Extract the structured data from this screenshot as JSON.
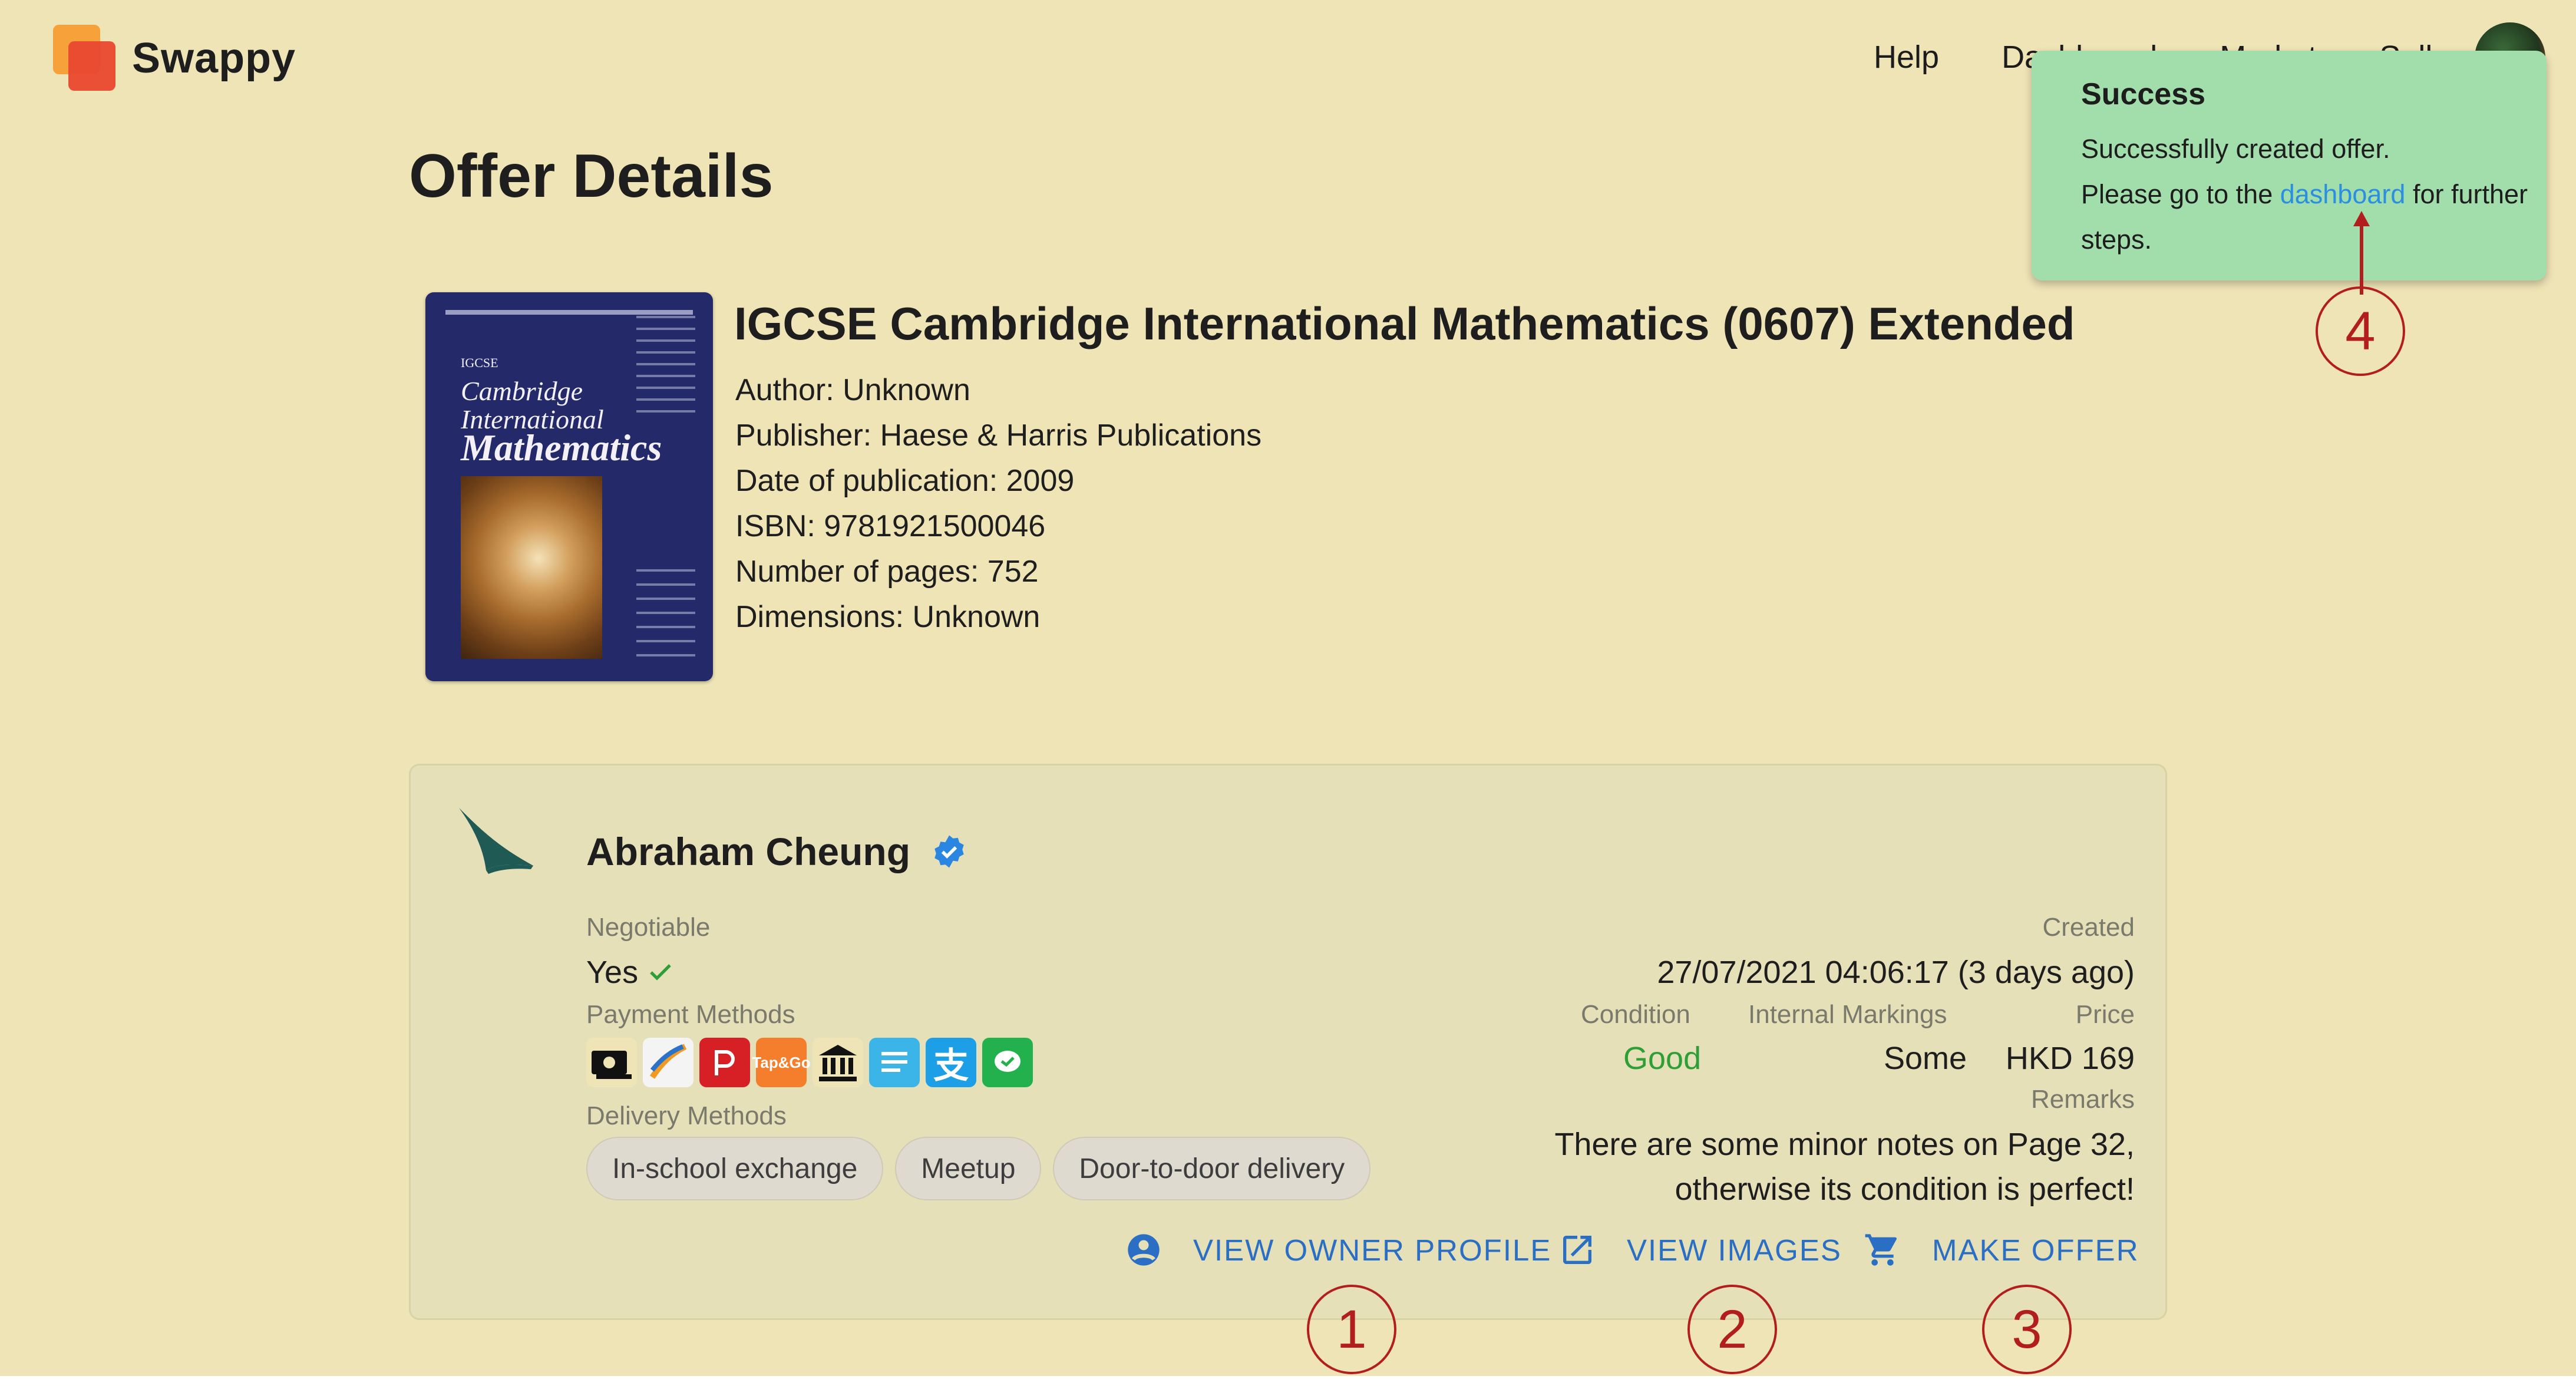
{
  "app": {
    "name": "Swappy"
  },
  "nav": {
    "items": [
      "Help",
      "Dashboard",
      "Market",
      "Sell"
    ]
  },
  "toast": {
    "title": "Success",
    "line1": "Successfully created offer.",
    "before_link": "Please go to the ",
    "link": "dashboard",
    "after_link": " for further steps."
  },
  "annotations": [
    "1",
    "2",
    "3",
    "4"
  ],
  "page": {
    "title": "Offer Details"
  },
  "book": {
    "title": "IGCSE Cambridge International Mathematics (0607) Extended",
    "author": "Author: Unknown",
    "publisher": "Publisher: Haese & Harris Publications",
    "date": "Date of publication: 2009",
    "isbn": "ISBN: 9781921500046",
    "pages": "Number of pages: 752",
    "dimensions": "Dimensions: Unknown",
    "cover": {
      "line1": "IGCSE",
      "line2": "Cambridge",
      "line3": "International",
      "line4": "Mathematics"
    }
  },
  "offer": {
    "seller": "Abraham Cheung",
    "negotiable_label": "Negotiable",
    "negotiable_value": "Yes",
    "payment_label": "Payment Methods",
    "payment_icons": [
      "cash-icon",
      "octopus-icon",
      "payme-icon",
      "tap-and-go-icon",
      "bank-icon",
      "fps-icon",
      "alipay-icon",
      "wechat-pay-icon"
    ],
    "delivery_label": "Delivery Methods",
    "delivery_methods": [
      "In-school exchange",
      "Meetup",
      "Door-to-door delivery"
    ],
    "created_label": "Created",
    "created_value": "27/07/2021 04:06:17 (3 days ago)",
    "condition_label": "Condition",
    "condition_value": "Good",
    "markings_label": "Internal Markings",
    "markings_value": "Some",
    "price_label": "Price",
    "price_value": "HKD 169",
    "remarks_label": "Remarks",
    "remarks_line1": "There are some minor notes on Page 32,",
    "remarks_line2": "otherwise its condition is perfect!",
    "actions": {
      "view_profile": "VIEW OWNER PROFILE",
      "view_images": "VIEW IMAGES",
      "make_offer": "MAKE OFFER"
    }
  },
  "colors": {
    "background": "#efe4b6",
    "card": "#e6e0b8",
    "toast": "#a2deab",
    "accent": "#2a6fc4",
    "good": "#2e9e36",
    "annotation": "#b21e1e"
  }
}
